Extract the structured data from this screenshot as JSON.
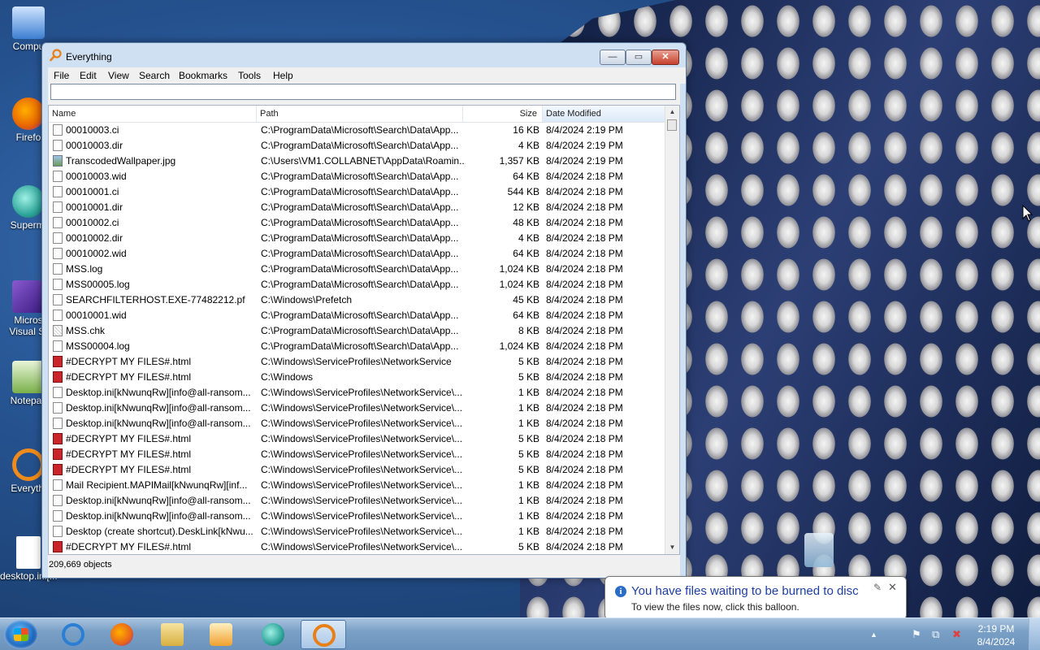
{
  "desktop": {
    "icons": [
      {
        "label": "Compu",
        "color": "#3d7fd1"
      },
      {
        "label": "Firefo",
        "color": "#e66000"
      },
      {
        "label": "Supermi",
        "color": "#2ea59a"
      },
      {
        "label": "Micros Visual St",
        "color": "#6a3ab0"
      },
      {
        "label": "Notepac",
        "color": "#7ab04a"
      },
      {
        "label": "Everythi",
        "color": "#f08a1a"
      },
      {
        "label": "desktop.ini[...",
        "color": "#ffffff"
      }
    ]
  },
  "window": {
    "title": "Everything",
    "buttons": {
      "minimize": "—",
      "maximize": "▭",
      "close": "✕"
    },
    "menu": [
      "File",
      "Edit",
      "View",
      "Search",
      "Bookmarks",
      "Tools",
      "Help"
    ],
    "search": {
      "value": "",
      "placeholder": ""
    },
    "columns": {
      "name": "Name",
      "path": "Path",
      "size": "Size",
      "date": "Date Modified"
    },
    "rows": [
      {
        "icon": "file",
        "name": "00010003.ci",
        "path": "C:\\ProgramData\\Microsoft\\Search\\Data\\App...",
        "size": "16 KB",
        "date": "8/4/2024 2:19 PM"
      },
      {
        "icon": "file",
        "name": "00010003.dir",
        "path": "C:\\ProgramData\\Microsoft\\Search\\Data\\App...",
        "size": "4 KB",
        "date": "8/4/2024 2:19 PM"
      },
      {
        "icon": "image",
        "name": "TranscodedWallpaper.jpg",
        "path": "C:\\Users\\VM1.COLLABNET\\AppData\\Roamin...",
        "size": "1,357 KB",
        "date": "8/4/2024 2:19 PM"
      },
      {
        "icon": "file",
        "name": "00010003.wid",
        "path": "C:\\ProgramData\\Microsoft\\Search\\Data\\App...",
        "size": "64 KB",
        "date": "8/4/2024 2:18 PM"
      },
      {
        "icon": "file",
        "name": "00010001.ci",
        "path": "C:\\ProgramData\\Microsoft\\Search\\Data\\App...",
        "size": "544 KB",
        "date": "8/4/2024 2:18 PM"
      },
      {
        "icon": "file",
        "name": "00010001.dir",
        "path": "C:\\ProgramData\\Microsoft\\Search\\Data\\App...",
        "size": "12 KB",
        "date": "8/4/2024 2:18 PM"
      },
      {
        "icon": "file",
        "name": "00010002.ci",
        "path": "C:\\ProgramData\\Microsoft\\Search\\Data\\App...",
        "size": "48 KB",
        "date": "8/4/2024 2:18 PM"
      },
      {
        "icon": "file",
        "name": "00010002.dir",
        "path": "C:\\ProgramData\\Microsoft\\Search\\Data\\App...",
        "size": "4 KB",
        "date": "8/4/2024 2:18 PM"
      },
      {
        "icon": "file",
        "name": "00010002.wid",
        "path": "C:\\ProgramData\\Microsoft\\Search\\Data\\App...",
        "size": "64 KB",
        "date": "8/4/2024 2:18 PM"
      },
      {
        "icon": "file",
        "name": "MSS.log",
        "path": "C:\\ProgramData\\Microsoft\\Search\\Data\\App...",
        "size": "1,024 KB",
        "date": "8/4/2024 2:18 PM"
      },
      {
        "icon": "file",
        "name": "MSS00005.log",
        "path": "C:\\ProgramData\\Microsoft\\Search\\Data\\App...",
        "size": "1,024 KB",
        "date": "8/4/2024 2:18 PM"
      },
      {
        "icon": "file",
        "name": "SEARCHFILTERHOST.EXE-77482212.pf",
        "path": "C:\\Windows\\Prefetch",
        "size": "45 KB",
        "date": "8/4/2024 2:18 PM"
      },
      {
        "icon": "file",
        "name": "00010001.wid",
        "path": "C:\\ProgramData\\Microsoft\\Search\\Data\\App...",
        "size": "64 KB",
        "date": "8/4/2024 2:18 PM"
      },
      {
        "icon": "chk",
        "name": "MSS.chk",
        "path": "C:\\ProgramData\\Microsoft\\Search\\Data\\App...",
        "size": "8 KB",
        "date": "8/4/2024 2:18 PM"
      },
      {
        "icon": "file",
        "name": "MSS00004.log",
        "path": "C:\\ProgramData\\Microsoft\\Search\\Data\\App...",
        "size": "1,024 KB",
        "date": "8/4/2024 2:18 PM"
      },
      {
        "icon": "html",
        "name": "#DECRYPT MY FILES#.html",
        "path": "C:\\Windows\\ServiceProfiles\\NetworkService",
        "size": "5 KB",
        "date": "8/4/2024 2:18 PM"
      },
      {
        "icon": "html",
        "name": "#DECRYPT MY FILES#.html",
        "path": "C:\\Windows",
        "size": "5 KB",
        "date": "8/4/2024 2:18 PM"
      },
      {
        "icon": "file",
        "name": "Desktop.ini[kNwunqRw][info@all-ransom...",
        "path": "C:\\Windows\\ServiceProfiles\\NetworkService\\...",
        "size": "1 KB",
        "date": "8/4/2024 2:18 PM"
      },
      {
        "icon": "file",
        "name": "Desktop.ini[kNwunqRw][info@all-ransom...",
        "path": "C:\\Windows\\ServiceProfiles\\NetworkService\\...",
        "size": "1 KB",
        "date": "8/4/2024 2:18 PM"
      },
      {
        "icon": "file",
        "name": "Desktop.ini[kNwunqRw][info@all-ransom...",
        "path": "C:\\Windows\\ServiceProfiles\\NetworkService\\...",
        "size": "1 KB",
        "date": "8/4/2024 2:18 PM"
      },
      {
        "icon": "html",
        "name": "#DECRYPT MY FILES#.html",
        "path": "C:\\Windows\\ServiceProfiles\\NetworkService\\...",
        "size": "5 KB",
        "date": "8/4/2024 2:18 PM"
      },
      {
        "icon": "html",
        "name": "#DECRYPT MY FILES#.html",
        "path": "C:\\Windows\\ServiceProfiles\\NetworkService\\...",
        "size": "5 KB",
        "date": "8/4/2024 2:18 PM"
      },
      {
        "icon": "html",
        "name": "#DECRYPT MY FILES#.html",
        "path": "C:\\Windows\\ServiceProfiles\\NetworkService\\...",
        "size": "5 KB",
        "date": "8/4/2024 2:18 PM"
      },
      {
        "icon": "file",
        "name": "Mail Recipient.MAPIMail[kNwunqRw][inf...",
        "path": "C:\\Windows\\ServiceProfiles\\NetworkService\\...",
        "size": "1 KB",
        "date": "8/4/2024 2:18 PM"
      },
      {
        "icon": "file",
        "name": "Desktop.ini[kNwunqRw][info@all-ransom...",
        "path": "C:\\Windows\\ServiceProfiles\\NetworkService\\...",
        "size": "1 KB",
        "date": "8/4/2024 2:18 PM"
      },
      {
        "icon": "file",
        "name": "Desktop.ini[kNwunqRw][info@all-ransom...",
        "path": "C:\\Windows\\ServiceProfiles\\NetworkService\\...",
        "size": "1 KB",
        "date": "8/4/2024 2:18 PM"
      },
      {
        "icon": "file",
        "name": "Desktop (create shortcut).DeskLink[kNwu...",
        "path": "C:\\Windows\\ServiceProfiles\\NetworkService\\...",
        "size": "1 KB",
        "date": "8/4/2024 2:18 PM"
      },
      {
        "icon": "html",
        "name": "#DECRYPT MY FILES#.html",
        "path": "C:\\Windows\\ServiceProfiles\\NetworkService\\...",
        "size": "5 KB",
        "date": "8/4/2024 2:18 PM"
      }
    ],
    "status": "209,669 objects"
  },
  "balloon": {
    "title": "You have files waiting to be burned to disc",
    "body": "To view the files now, click this balloon.",
    "info_glyph": "i",
    "pin_glyph": "✎",
    "close_glyph": "✕"
  },
  "taskbar": {
    "apps": [
      {
        "name": "internet-explorer",
        "color": "#2a7fd4"
      },
      {
        "name": "firefox",
        "color": "#e8641a"
      },
      {
        "name": "file-explorer",
        "color": "#e6c45a"
      },
      {
        "name": "media-player",
        "color": "#f0a030"
      },
      {
        "name": "supermium",
        "color": "#2ea59a"
      },
      {
        "name": "everything",
        "color": "#f08a1a"
      }
    ],
    "tray": {
      "up_arrow": "▲",
      "flag": "⚑",
      "network": "⧉",
      "volume": "✖"
    },
    "clock": {
      "time": "2:19 PM",
      "date": "8/4/2024"
    }
  }
}
